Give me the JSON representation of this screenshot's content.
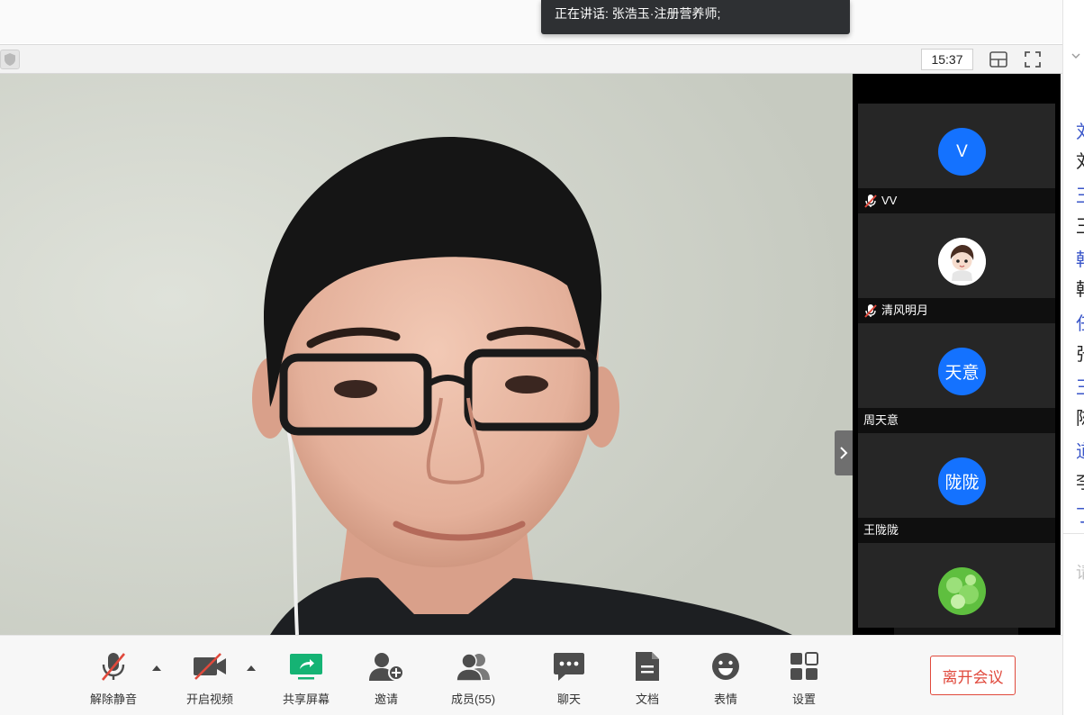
{
  "speaker_bar": {
    "text": "正在讲话: 张浩玉·注册营养师;"
  },
  "meeting_bar": {
    "time": "15:37"
  },
  "participants": [
    {
      "name": "VV",
      "avatar_text": "V",
      "muted": true
    },
    {
      "name": "清风明月",
      "avatar_text": "",
      "muted": true
    },
    {
      "name": "周天意",
      "avatar_text": "天意",
      "muted": false
    },
    {
      "name": "王陇陇",
      "avatar_text": "陇陇",
      "muted": false
    }
  ],
  "toolbar": {
    "unmute": "解除静音",
    "start_video": "开启视频",
    "share_screen": "共享屏幕",
    "invite": "邀请",
    "members": "成员(55)",
    "chat": "聊天",
    "documents": "文档",
    "reactions": "表情",
    "settings": "设置",
    "leave": "离开会议"
  },
  "chat_strip": {
    "lines": [
      {
        "kind": "name",
        "text": "刘"
      },
      {
        "kind": "msg",
        "text": "刘"
      },
      {
        "kind": "name",
        "text": "王"
      },
      {
        "kind": "msg",
        "text": "王"
      },
      {
        "kind": "name",
        "text": "韩"
      },
      {
        "kind": "msg",
        "text": "韩"
      },
      {
        "kind": "name",
        "text": "任"
      },
      {
        "kind": "msg",
        "text": "张"
      },
      {
        "kind": "name",
        "text": "王"
      },
      {
        "kind": "msg",
        "text": "陈"
      },
      {
        "kind": "name",
        "text": "道"
      },
      {
        "kind": "msg",
        "text": "李"
      },
      {
        "kind": "name",
        "text": "丁"
      }
    ],
    "input_hint": "请"
  },
  "colors": {
    "accent_blue": "#1472ff",
    "share_green": "#15b374",
    "leave_red": "#e0493c",
    "muted_red": "#e0493c",
    "chat_name_blue": "#3a56c9"
  },
  "icons": {
    "security": "shield-icon",
    "layout": "layout-icon",
    "fullscreen": "fullscreen-icon",
    "unmute": "microphone-muted-icon",
    "start_video": "camera-off-icon",
    "share_screen": "share-screen-icon",
    "invite": "add-person-icon",
    "members": "people-icon",
    "chat": "chat-bubble-icon",
    "documents": "document-icon",
    "reactions": "smiley-icon",
    "settings": "grid-icon"
  }
}
